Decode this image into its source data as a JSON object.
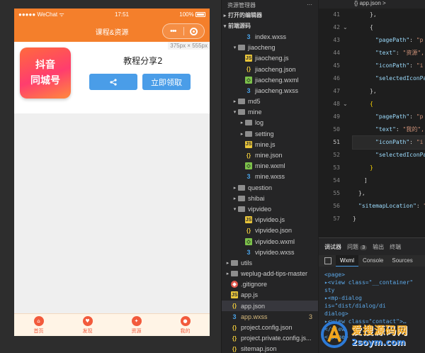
{
  "simulator": {
    "status": {
      "carrier": "●●●●● WeChat",
      "wifi": "ᯤ",
      "time": "17:51",
      "battery": "100%"
    },
    "nav": {
      "title": "课程&资源",
      "menu_dots": "•••"
    },
    "size_tip": "375px × 555px",
    "app_logo": [
      "抖音",
      "同城号"
    ],
    "tutorial_title": "教程分享2",
    "share_icon": "share-icon",
    "get_button": "立即领取",
    "tabs": [
      {
        "label": "首页",
        "icon": "home-icon"
      },
      {
        "label": "发现",
        "icon": "like-icon"
      },
      {
        "label": "资源",
        "icon": "gift-icon"
      },
      {
        "label": "我的",
        "icon": "user-icon"
      }
    ]
  },
  "explorer": {
    "header": "资源管理器",
    "header_more": "···",
    "open_editors": "打开的编辑器",
    "project": "前端源码",
    "tree": [
      {
        "name": "index.wxss",
        "type": "wxss",
        "depth": 2
      },
      {
        "name": "jiaocheng",
        "type": "folder",
        "depth": 1,
        "open": true
      },
      {
        "name": "jiaocheng.js",
        "type": "js",
        "depth": 2
      },
      {
        "name": "jiaocheng.json",
        "type": "json",
        "depth": 2
      },
      {
        "name": "jiaocheng.wxml",
        "type": "wxml",
        "depth": 2
      },
      {
        "name": "jiaocheng.wxss",
        "type": "wxss",
        "depth": 2
      },
      {
        "name": "md5",
        "type": "folder",
        "depth": 1,
        "open": false
      },
      {
        "name": "mine",
        "type": "folder",
        "depth": 1,
        "open": true
      },
      {
        "name": "log",
        "type": "folder",
        "depth": 2,
        "open": false
      },
      {
        "name": "setting",
        "type": "folder",
        "depth": 2,
        "open": false
      },
      {
        "name": "mine.js",
        "type": "js",
        "depth": 2
      },
      {
        "name": "mine.json",
        "type": "json",
        "depth": 2
      },
      {
        "name": "mine.wxml",
        "type": "wxml",
        "depth": 2
      },
      {
        "name": "mine.wxss",
        "type": "wxss",
        "depth": 2
      },
      {
        "name": "question",
        "type": "folder",
        "depth": 1,
        "open": false
      },
      {
        "name": "shibai",
        "type": "folder",
        "depth": 1,
        "open": false
      },
      {
        "name": "vipvideo",
        "type": "folder",
        "depth": 1,
        "open": true
      },
      {
        "name": "vipvideo.js",
        "type": "js",
        "depth": 2
      },
      {
        "name": "vipvideo.json",
        "type": "json",
        "depth": 2
      },
      {
        "name": "vipvideo.wxml",
        "type": "wxml",
        "depth": 2
      },
      {
        "name": "vipvideo.wxss",
        "type": "wxss",
        "depth": 2
      },
      {
        "name": "utils",
        "type": "folder",
        "depth": 0,
        "open": false
      },
      {
        "name": "weplug-add-tips-master",
        "type": "folder",
        "depth": 0,
        "open": false
      },
      {
        "name": ".gitignore",
        "type": "git",
        "depth": 0
      },
      {
        "name": "app.js",
        "type": "js",
        "depth": 0
      },
      {
        "name": "app.json",
        "type": "json",
        "depth": 0,
        "active": true
      },
      {
        "name": "app.wxss",
        "type": "wxss",
        "depth": 0,
        "badge": "3"
      },
      {
        "name": "project.config.json",
        "type": "json",
        "depth": 0
      },
      {
        "name": "project.private.config.js...",
        "type": "json",
        "depth": 0
      },
      {
        "name": "sitemap.json",
        "type": "json",
        "depth": 0
      }
    ]
  },
  "editor": {
    "tab": "{} app.json >",
    "lines": [
      {
        "n": "41",
        "html": "<span class='p'>},</span>",
        "indent": 2
      },
      {
        "n": "42",
        "html": "<span class='p'>{</span>",
        "indent": 2,
        "fold": true
      },
      {
        "n": "43",
        "html": "<span class='k'>\"pagePath\"</span><span class='p'>: </span><span class='s'>\"p</span>",
        "indent": 3
      },
      {
        "n": "44",
        "html": "<span class='k'>\"text\"</span><span class='p'>: </span><span class='s'>\"资源\",</span>",
        "indent": 3
      },
      {
        "n": "45",
        "html": "<span class='k'>\"iconPath\"</span><span class='p'>: </span><span class='s'>\"i</span>",
        "indent": 3
      },
      {
        "n": "46",
        "html": "<span class='k'>\"selectedIconPa</span>",
        "indent": 3
      },
      {
        "n": "47",
        "html": "<span class='p'>},</span>",
        "indent": 2
      },
      {
        "n": "48",
        "html": "<span class='y'>{</span>",
        "indent": 2,
        "fold": true
      },
      {
        "n": "49",
        "html": "<span class='k'>\"pagePath\"</span><span class='p'>: </span><span class='s'>\"p</span>",
        "indent": 3
      },
      {
        "n": "50",
        "html": "<span class='k'>\"text\"</span><span class='p'>: </span><span class='s'>\"我的\",</span>",
        "indent": 3
      },
      {
        "n": "51",
        "html": "<span class='k'>\"iconPath\"</span><span class='p'>: </span><span class='s'>\"i</span>",
        "indent": 3,
        "current": true
      },
      {
        "n": "52",
        "html": "<span class='k'>\"selectedIconPa</span>",
        "indent": 3
      },
      {
        "n": "53",
        "html": "<span class='y'>}</span>",
        "indent": 2
      },
      {
        "n": "54",
        "html": "<span class='p'>]</span>",
        "indent": 1
      },
      {
        "n": "55",
        "html": "<span class='p'>},</span>",
        "indent": 0
      },
      {
        "n": "56",
        "html": "<span class='k'>\"sitemapLocation\"</span><span class='p'>: </span><span class='s'>\"</span>",
        "indent": 0
      },
      {
        "n": "57",
        "html": "<span class='p'>}</span>",
        "indent": -1
      }
    ]
  },
  "debugger": {
    "tabs": [
      "调试器",
      "问题",
      "输出",
      "终端"
    ],
    "problem_count": "3",
    "panels": [
      "Wxml",
      "Console",
      "Sources"
    ],
    "dom": [
      "<page>",
      "▸<view class=\"__container\" sty",
      "▸<mp-dialog is=\"dist/dialog/di",
      "dialog>",
      "▸<view class=\"contact\">…</view",
      "</page>"
    ]
  },
  "watermark": {
    "line1": "爱搜源码网",
    "line2": "2soym.com"
  }
}
